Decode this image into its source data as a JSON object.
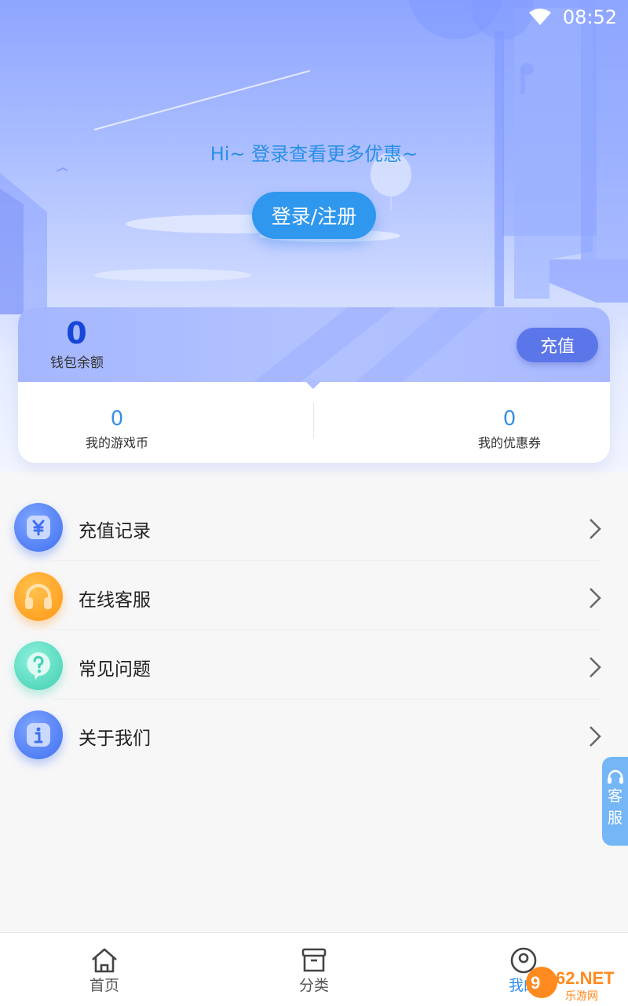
{
  "status_bar": {
    "time": "08:52"
  },
  "hero": {
    "greeting": "Hi~  登录查看更多优惠~",
    "login_label": "登录/注册"
  },
  "wallet": {
    "balance_value": "0",
    "balance_label": "钱包余额",
    "recharge_label": "充值",
    "coins_value": "0",
    "coins_label": "我的游戏币",
    "coupons_value": "0",
    "coupons_label": "我的优惠券"
  },
  "menu": {
    "items": [
      {
        "label": "充值记录",
        "icon": "yen-icon",
        "color": "#4a7cf4"
      },
      {
        "label": "在线客服",
        "icon": "headphones-icon",
        "color": "#ffa41f"
      },
      {
        "label": "常见问题",
        "icon": "question-bubble-icon",
        "color": "#48d3b8"
      },
      {
        "label": "关于我们",
        "icon": "info-icon",
        "color": "#4a7cf4"
      }
    ]
  },
  "float_service": {
    "line1": "客",
    "line2": "服"
  },
  "bottom_nav": {
    "items": [
      {
        "label": "首页",
        "icon": "home-icon"
      },
      {
        "label": "分类",
        "icon": "category-box-icon"
      },
      {
        "label": "我的",
        "icon": "user-icon",
        "active": true
      }
    ]
  },
  "watermark": {
    "text": "962.NET",
    "sub": "乐游网"
  },
  "colors": {
    "accent": "#2f97ee",
    "balance": "#1546d8",
    "recharge": "#5b76e8"
  }
}
